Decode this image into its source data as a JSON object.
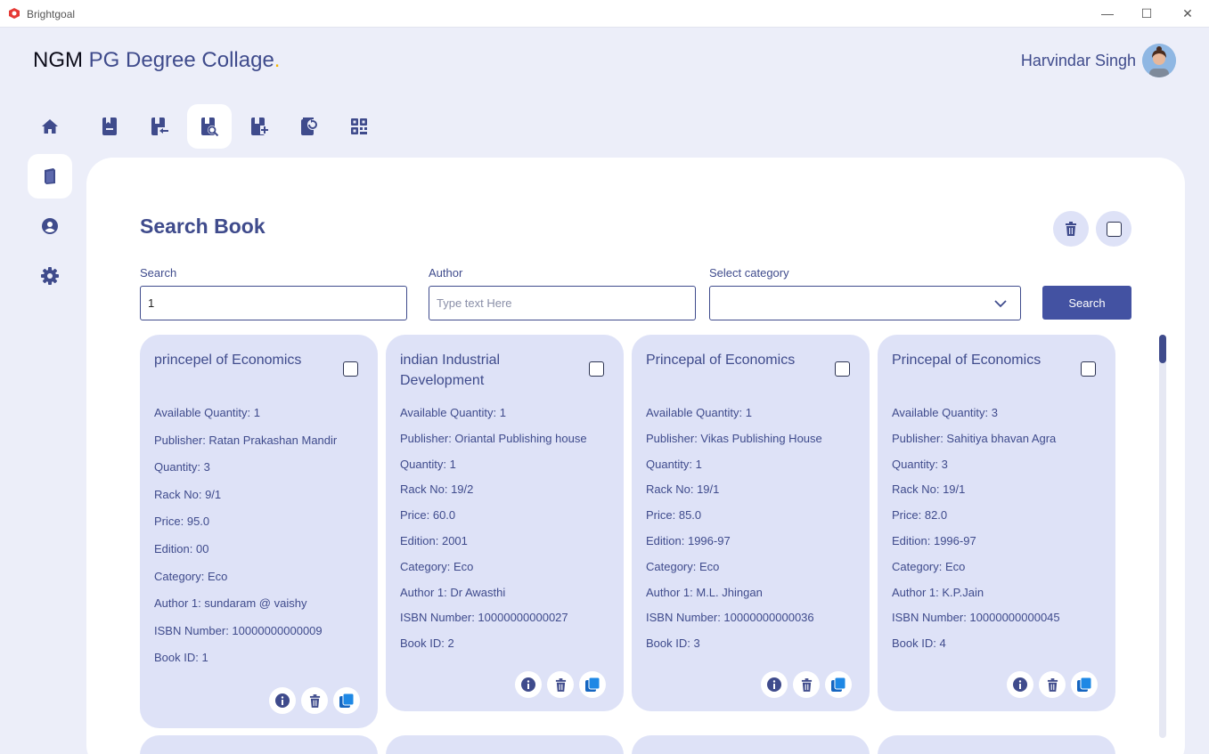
{
  "window": {
    "app_title": "Brightgoal",
    "minimize_glyph": "—",
    "maximize_glyph": "☐",
    "close_glyph": "✕"
  },
  "header": {
    "brand_part1": "NGM",
    "brand_part2": "PG Degree Collage",
    "brand_dot": ".",
    "user_name": "Harvindar Singh"
  },
  "sidebar": {
    "items": [
      {
        "icon": "home-icon",
        "active": false
      },
      {
        "icon": "book-icon",
        "active": true
      },
      {
        "icon": "user-circle-icon",
        "active": false
      },
      {
        "icon": "gear-icon",
        "active": false
      }
    ]
  },
  "toolbar": {
    "items": [
      {
        "icon": "book-list-icon",
        "active": false
      },
      {
        "icon": "book-return-icon",
        "active": false
      },
      {
        "icon": "book-search-icon",
        "active": true
      },
      {
        "icon": "book-add-icon",
        "active": false
      },
      {
        "icon": "book-renew-icon",
        "active": false
      },
      {
        "icon": "qr-code-icon",
        "active": false
      }
    ]
  },
  "page": {
    "title": "Search Book"
  },
  "form": {
    "search_label": "Search",
    "search_value": "1",
    "author_label": "Author",
    "author_placeholder": "Type text Here",
    "category_label": "Select category",
    "category_value": "",
    "search_button": "Search"
  },
  "colors": {
    "accent": "#4352a2",
    "text": "#3f4b8c",
    "card_bg": "#dee2f7",
    "page_bg": "#eceef9",
    "action_icon_blue": "#1e88e5"
  },
  "cards": [
    {
      "title": "princepel of Economics",
      "lines": [
        "Available Quantity: 1",
        "Publisher: Ratan Prakashan Mandir",
        "Quantity: 3",
        "Rack No: 9/1",
        "Price: 95.0",
        "Edition: 00",
        "Category: Eco",
        "Author 1: sundaram @ vaishy",
        "ISBN Number: 10000000000009",
        "Book ID: 1"
      ]
    },
    {
      "title": "indian Industrial Development",
      "lines": [
        "Available Quantity: 1",
        "Publisher: Oriantal Publishing house",
        "Quantity: 1",
        "Rack No: 19/2",
        "Price: 60.0",
        "Edition: 2001",
        "Category: Eco",
        "Author 1: Dr Awasthi",
        "ISBN Number: 10000000000027",
        "Book ID: 2"
      ]
    },
    {
      "title": "Princepal of Economics",
      "lines": [
        "Available Quantity: 1",
        "Publisher: Vikas Publishing House",
        "Quantity: 1",
        "Rack No: 19/1",
        "Price: 85.0",
        "Edition: 1996-97",
        "Category: Eco",
        "Author 1: M.L. Jhingan",
        "ISBN Number: 10000000000036",
        "Book ID: 3"
      ]
    },
    {
      "title": "Princepal of Economics",
      "lines": [
        "Available Quantity: 3",
        "Publisher: Sahitiya bhavan Agra",
        "Quantity: 3",
        "Rack No: 19/1",
        "Price: 82.0",
        "Edition: 1996-97",
        "Category: Eco",
        "Author 1: K.P.Jain",
        "ISBN Number: 10000000000045",
        "Book ID: 4"
      ]
    }
  ]
}
